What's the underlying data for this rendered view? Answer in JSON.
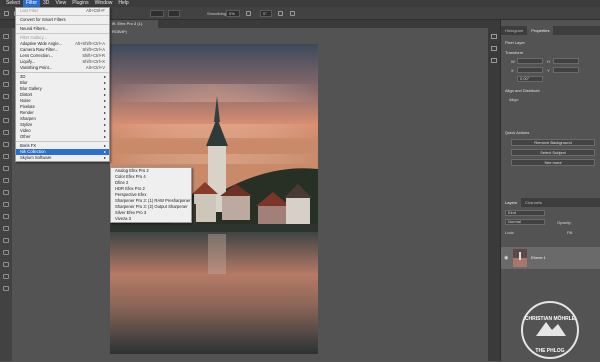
{
  "menubar": {
    "items": [
      "Select",
      "Filter",
      "3D",
      "View",
      "Plugins",
      "Window",
      "Help"
    ],
    "active_index": 1
  },
  "options_bar": {
    "smoothing_label": "Smoothing:",
    "smoothing_value": "0%",
    "size_value": "0°",
    "angle_value": "0°"
  },
  "document_tab": {
    "title": "Ift. Efex Pro 3 (1). RGB/8*)"
  },
  "filter_menu": {
    "items": [
      {
        "label": "Last Filter",
        "shortcut": "Alt+Ctrl+F",
        "disabled": true
      },
      {
        "sep": true
      },
      {
        "label": "Convert for Smart Filters"
      },
      {
        "sep": true
      },
      {
        "label": "Neural Filters..."
      },
      {
        "sep": true
      },
      {
        "label": "Filter Gallery...",
        "disabled": true
      },
      {
        "label": "Adaptive Wide Angle...",
        "shortcut": "Alt+Shift+Ctrl+A"
      },
      {
        "label": "Camera Raw Filter...",
        "shortcut": "Shift+Ctrl+A"
      },
      {
        "label": "Lens Correction...",
        "shortcut": "Shift+Ctrl+R"
      },
      {
        "label": "Liquify...",
        "shortcut": "Shift+Ctrl+X"
      },
      {
        "label": "Vanishing Point...",
        "shortcut": "Alt+Ctrl+V"
      },
      {
        "sep": true
      },
      {
        "label": "3D",
        "submenu": true
      },
      {
        "label": "Blur",
        "submenu": true
      },
      {
        "label": "Blur Gallery",
        "submenu": true
      },
      {
        "label": "Distort",
        "submenu": true
      },
      {
        "label": "Noise",
        "submenu": true
      },
      {
        "label": "Pixelate",
        "submenu": true
      },
      {
        "label": "Render",
        "submenu": true
      },
      {
        "label": "Sharpen",
        "submenu": true
      },
      {
        "label": "Stylize",
        "submenu": true
      },
      {
        "label": "Video",
        "submenu": true
      },
      {
        "label": "Other",
        "submenu": true
      },
      {
        "sep": true
      },
      {
        "label": "Boris FX",
        "submenu": true
      },
      {
        "label": "Nik Collection",
        "submenu": true,
        "highlight": true
      },
      {
        "label": "Skylum Software",
        "submenu": true
      }
    ]
  },
  "nik_submenu": {
    "items": [
      "Analog Efex Pro 2",
      "Color Efex Pro 4",
      "Dfine 2",
      "HDR Efex Pro 2",
      "Perspective Efex",
      "Sharpener Pro 3: (1) RAW Presharpener",
      "Sharpener Pro 3: (2) Output Sharpener",
      "Silver Efex Pro 3",
      "Viveza 3"
    ]
  },
  "properties_panel": {
    "tabs": [
      "Histogram",
      "Properties"
    ],
    "active_tab": 1,
    "layer_type": "Pixel Layer",
    "transform_label": "Transform",
    "w_label": "W",
    "h_label": "H",
    "x_label": "X",
    "y_label": "Y",
    "angle_value": "0,00°",
    "align_label": "Align and Distribute",
    "align_sub": "Align:",
    "quick_actions_label": "Quick Actions",
    "buttons": [
      "Remove Background",
      "Select Subject",
      "See more"
    ]
  },
  "layers_panel": {
    "tabs": [
      "Layers",
      "Channels"
    ],
    "active_tab": 0,
    "kind_label": "Kind",
    "blend_mode": "Normal",
    "opacity_label": "Opacity:",
    "lock_label": "Lock:",
    "fill_label": "Fill:",
    "layer_name": "Ebene 1"
  },
  "watermark": {
    "top_text": "CHRISTIAN MÖHRLE",
    "bottom_text": "THE PHLOG"
  }
}
